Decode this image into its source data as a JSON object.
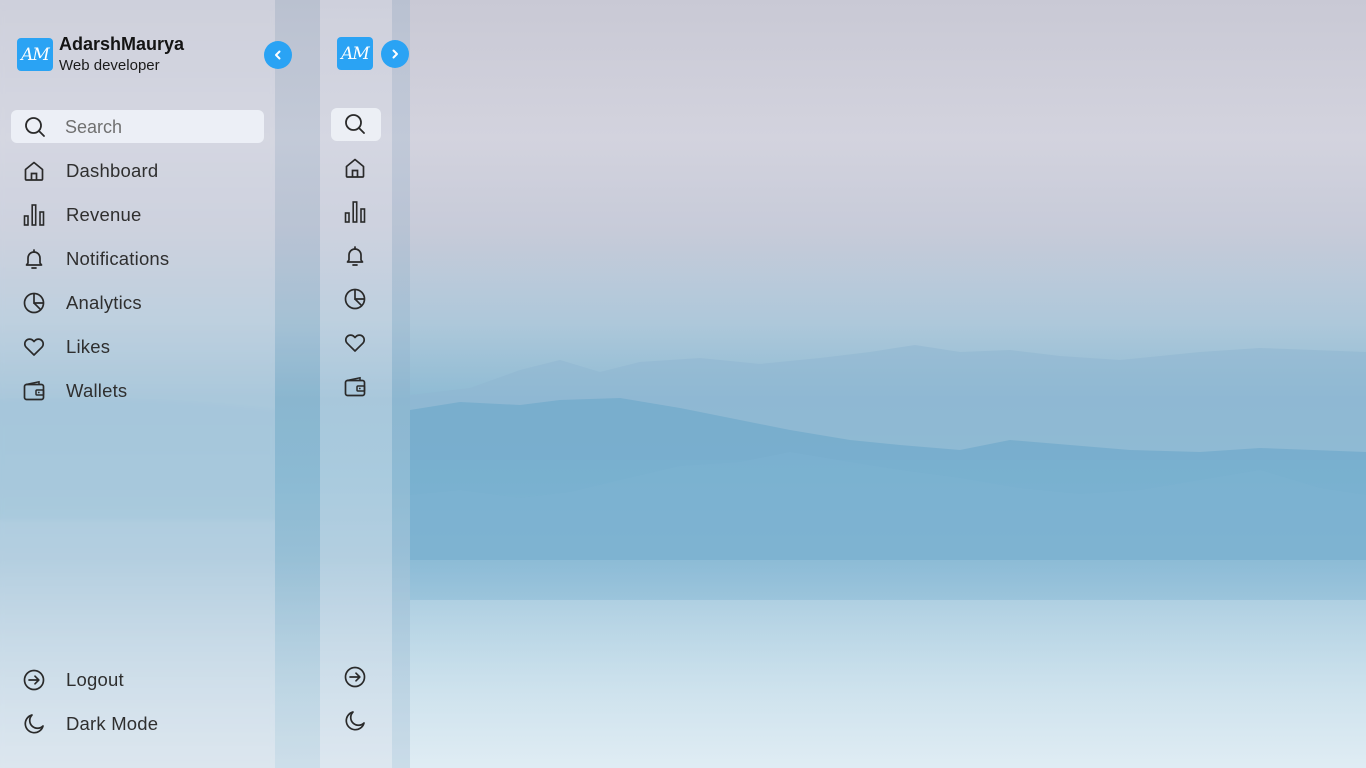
{
  "user": {
    "initials": "AM",
    "name": "AdarshMaurya",
    "role": "Web developer"
  },
  "search": {
    "placeholder": "Search",
    "value": ""
  },
  "menu": [
    {
      "label": "Dashboard",
      "icon": "home-icon"
    },
    {
      "label": "Revenue",
      "icon": "bar-chart-icon"
    },
    {
      "label": "Notifications",
      "icon": "bell-icon"
    },
    {
      "label": "Analytics",
      "icon": "pie-chart-icon"
    },
    {
      "label": "Likes",
      "icon": "heart-icon"
    },
    {
      "label": "Wallets",
      "icon": "wallet-icon"
    }
  ],
  "bottom": [
    {
      "label": "Logout",
      "icon": "logout-icon"
    },
    {
      "label": "Dark Mode",
      "icon": "moon-icon"
    }
  ],
  "colors": {
    "accent": "#2aa3f4",
    "text": "#2f2f2f"
  }
}
